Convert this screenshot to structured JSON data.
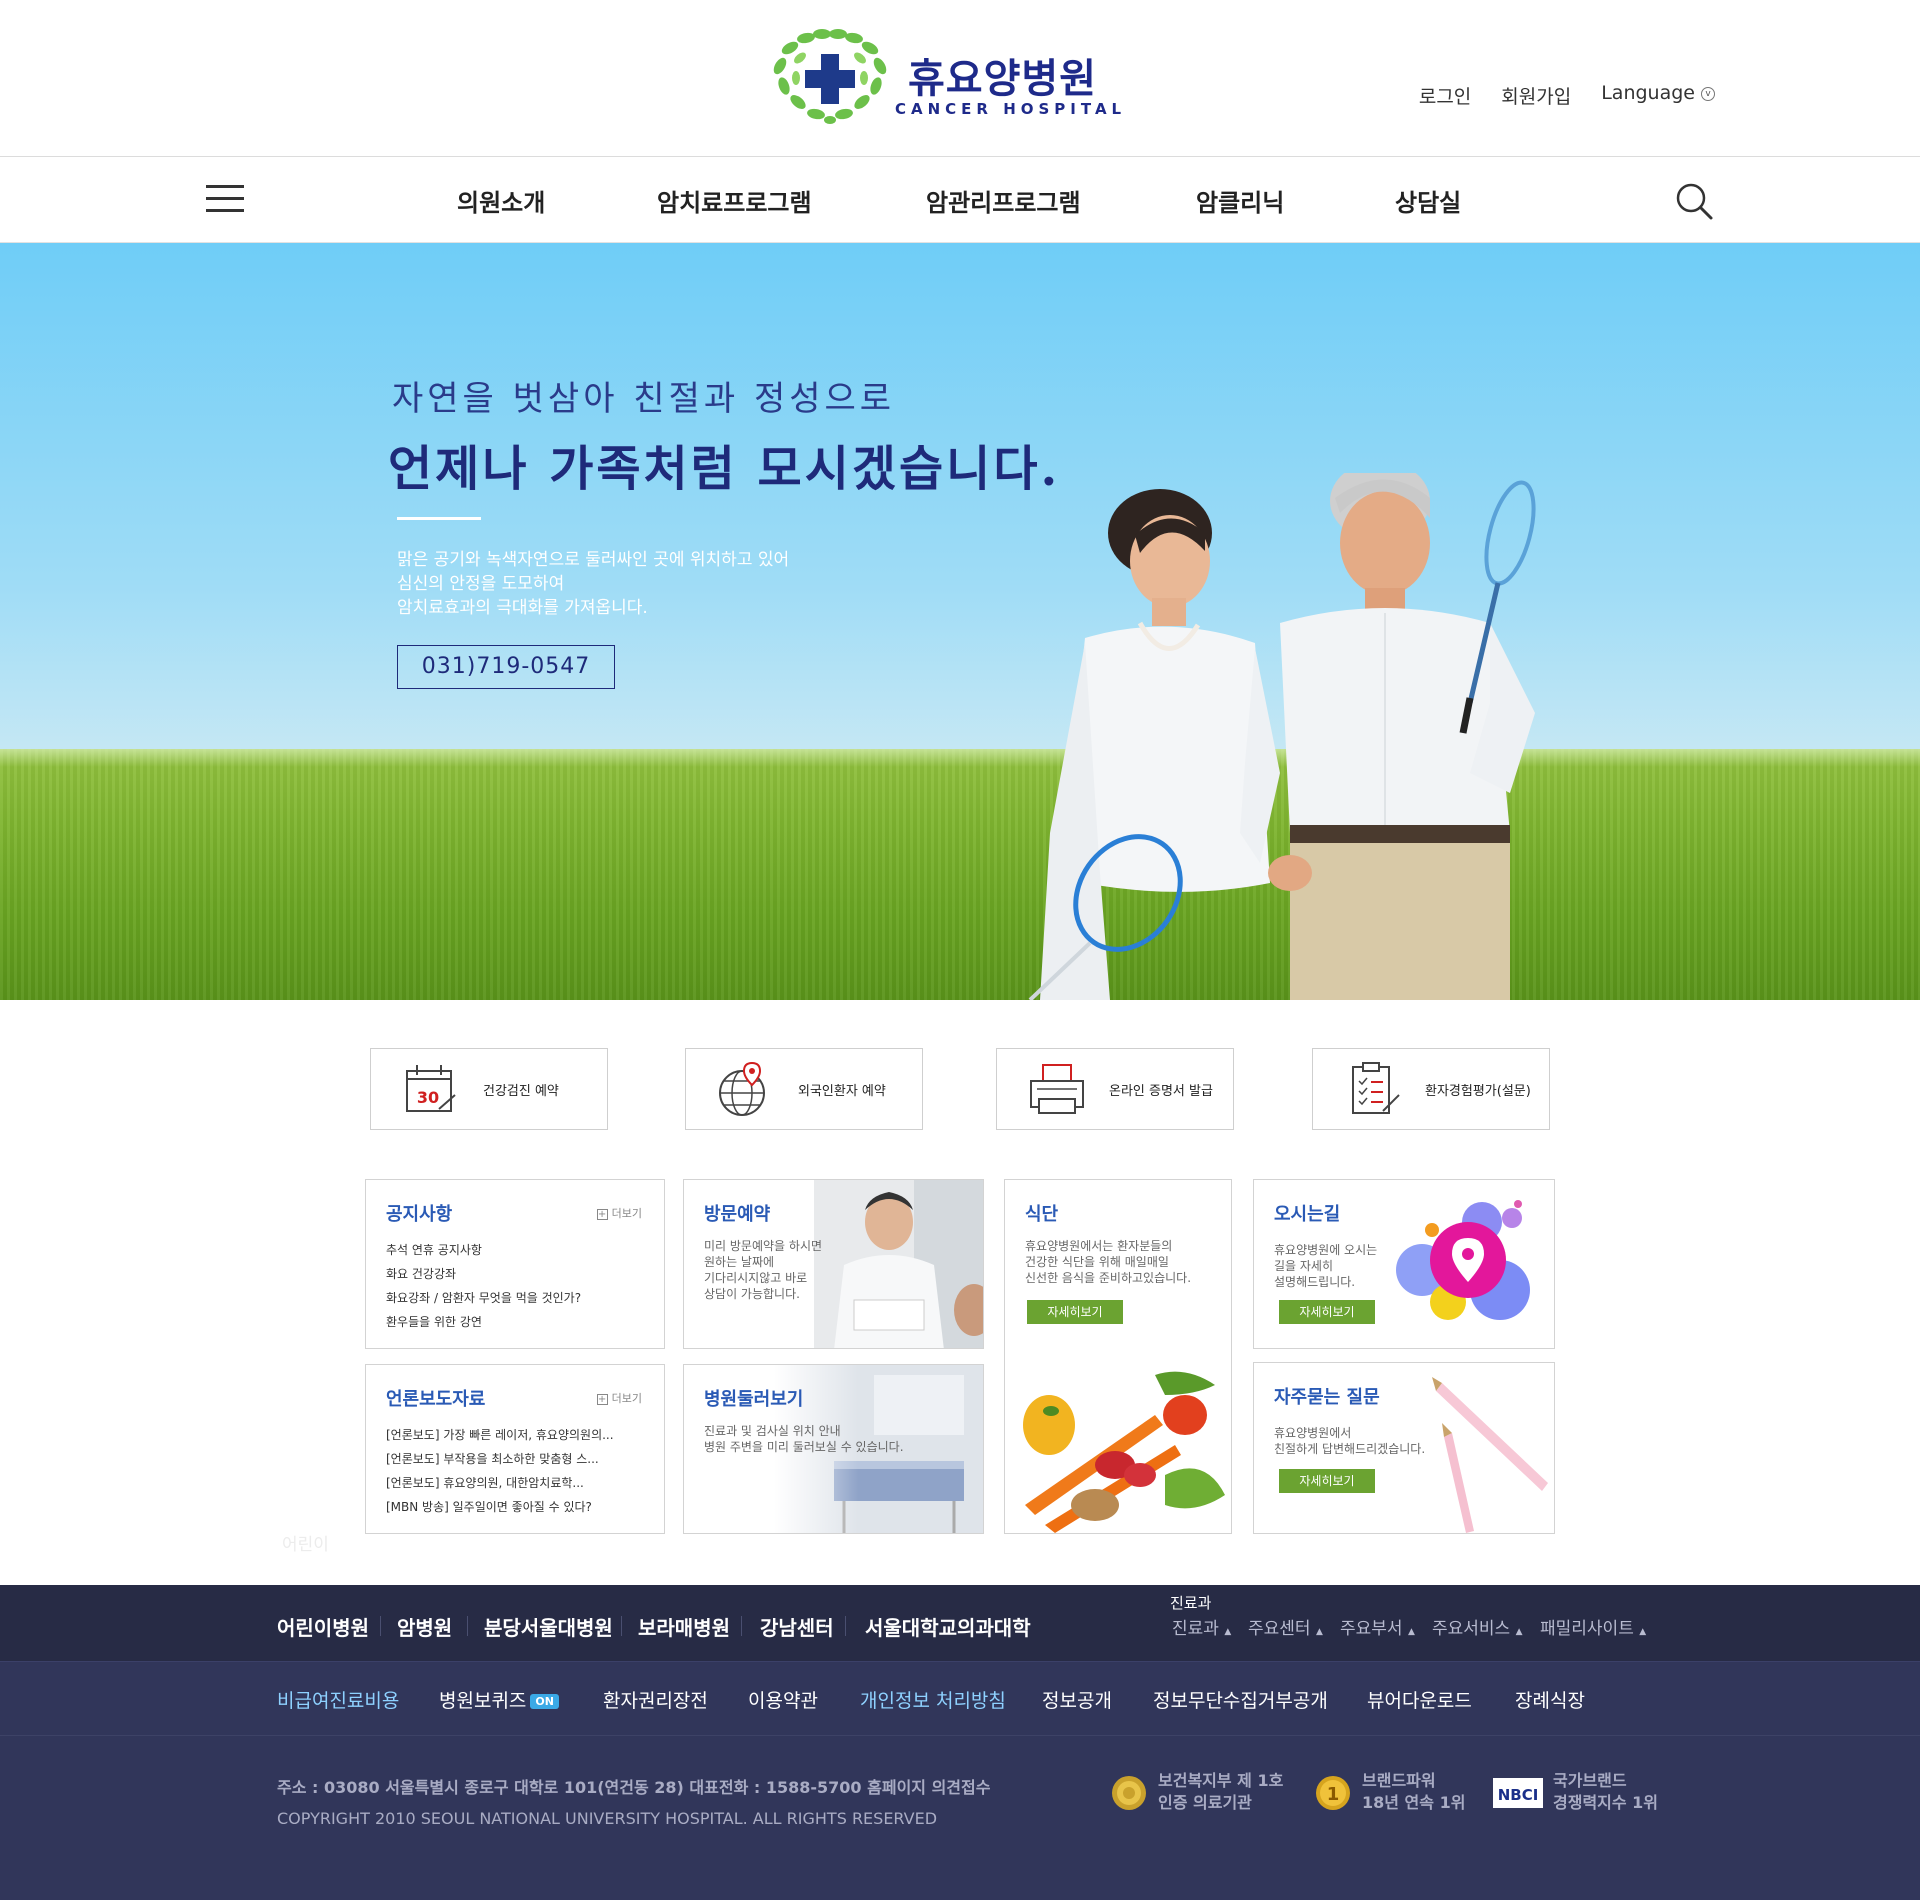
{
  "header": {
    "logo_title": "휴요양병원",
    "logo_sub": "CANCER HOSPITAL",
    "util": {
      "login": "로그인",
      "join": "회원가입",
      "language": "Language"
    }
  },
  "gnb": {
    "items": [
      "의원소개",
      "암치료프로그램",
      "암관리프로그램",
      "암클리닉",
      "상담실"
    ]
  },
  "hero": {
    "sub": "자연을 벗삼아 친절과 정성으로",
    "title": "언제나 가족처럼 모시겠습니다.",
    "desc": [
      "맑은 공기와 녹색자연으로 둘러싸인 곳에 위치하고 있어",
      "심신의 안정을 도모하여",
      "암치료효과의 극대화를 가져옵니다."
    ],
    "phone": "031)719-0547"
  },
  "quick": [
    {
      "label": "건강검진 예약",
      "icon": "calendar-icon",
      "day": "30"
    },
    {
      "label": "외국인환자 예약",
      "icon": "globe-pin-icon"
    },
    {
      "label": "온라인 증명서 발급",
      "icon": "printer-icon"
    },
    {
      "label": "환자경험평가(설문)",
      "icon": "clipboard-check-icon"
    }
  ],
  "notice": {
    "title": "공지사항",
    "more": "더보기",
    "items": [
      "추석 연휴 공지사항",
      "화요 건강강좌",
      "화요강좌 / 암환자 무엇을 먹을 것인가?",
      "환우들을 위한 강연"
    ]
  },
  "press": {
    "title": "언론보도자료",
    "more": "더보기",
    "items": [
      "[언론보도] 가장 빠른 레이저, 휴요양의원의...",
      "[언론보도] 부작용을 최소하한 맞춤형 스...",
      "[언론보도] 휴요양의원, 대한암치료학...",
      "[MBN 방송] 일주일이면 좋아질 수 있다?"
    ]
  },
  "visit": {
    "title": "방문예약",
    "desc": [
      "미리 방문예약을 하시면",
      "원하는 날짜에",
      "기다리시지않고 바로",
      "상담이 가능합니다."
    ]
  },
  "tour": {
    "title": "병원둘러보기",
    "desc": [
      "진료과 및 검사실 위치 안내",
      "병원 주변을 미리 둘러보실 수 있습니다."
    ]
  },
  "diet": {
    "title": "식단",
    "desc": [
      "휴요양병원에서는 환자분들의",
      "건강한 식단을 위해 매일매일",
      "신선한 음식을 준비하고있습니다."
    ],
    "button": "자세히보기"
  },
  "directions": {
    "title": "오시는길",
    "desc": [
      "휴요양병원에 오시는",
      "길을 자세히",
      "설명해드립니다."
    ],
    "button": "자세히보기"
  },
  "faq": {
    "title": "자주묻는 질문",
    "desc": [
      "휴요양병원에서",
      "친절하게 답변해드리겠습니다."
    ],
    "button": "자세히보기"
  },
  "faint_label": "어린이",
  "footer": {
    "family": [
      "어린이병원",
      "암병원",
      "분당서울대병원",
      "보라매병원",
      "강남센터",
      "서울대학교의과대학"
    ],
    "tooltip": "진료과",
    "dropdowns": [
      "진료과",
      "주요센터",
      "주요부서",
      "주요서비스",
      "패밀리사이트"
    ],
    "policy": [
      "비급여진료비용",
      "병원보퀴즈",
      "환자권리장전",
      "이용약관",
      "개인정보 처리방침",
      "정보공개",
      "정보무단수집거부공개",
      "뷰어다운로드",
      "장례식장"
    ],
    "on_badge": "ON",
    "address": "주소 : 03080 서울특별시 종로구 대학로 101(연건동 28)    대표전화 : 1588-5700    홈페이지 의견접수",
    "copyright": "COPYRIGHT 2010 SEOUL NATIONAL UNIVERSITY HOSPITAL. ALL RIGHTS RESERVED",
    "awards": [
      {
        "line1": "보건복지부 제 1호",
        "line2": "인증 의료기관"
      },
      {
        "line1": "브랜드파워",
        "line2": "18년 연속 1위",
        "mark": "1"
      },
      {
        "line1": "국가브랜드",
        "line2": "경쟁력지수 1위",
        "mark": "NBCI"
      }
    ]
  },
  "colors": {
    "brand_navy": "#1e2a8a",
    "accent_green": "#6ba331",
    "link_blue": "#2a5ab5",
    "footer_dark": "#272b45",
    "footer_mid": "#31365a"
  }
}
